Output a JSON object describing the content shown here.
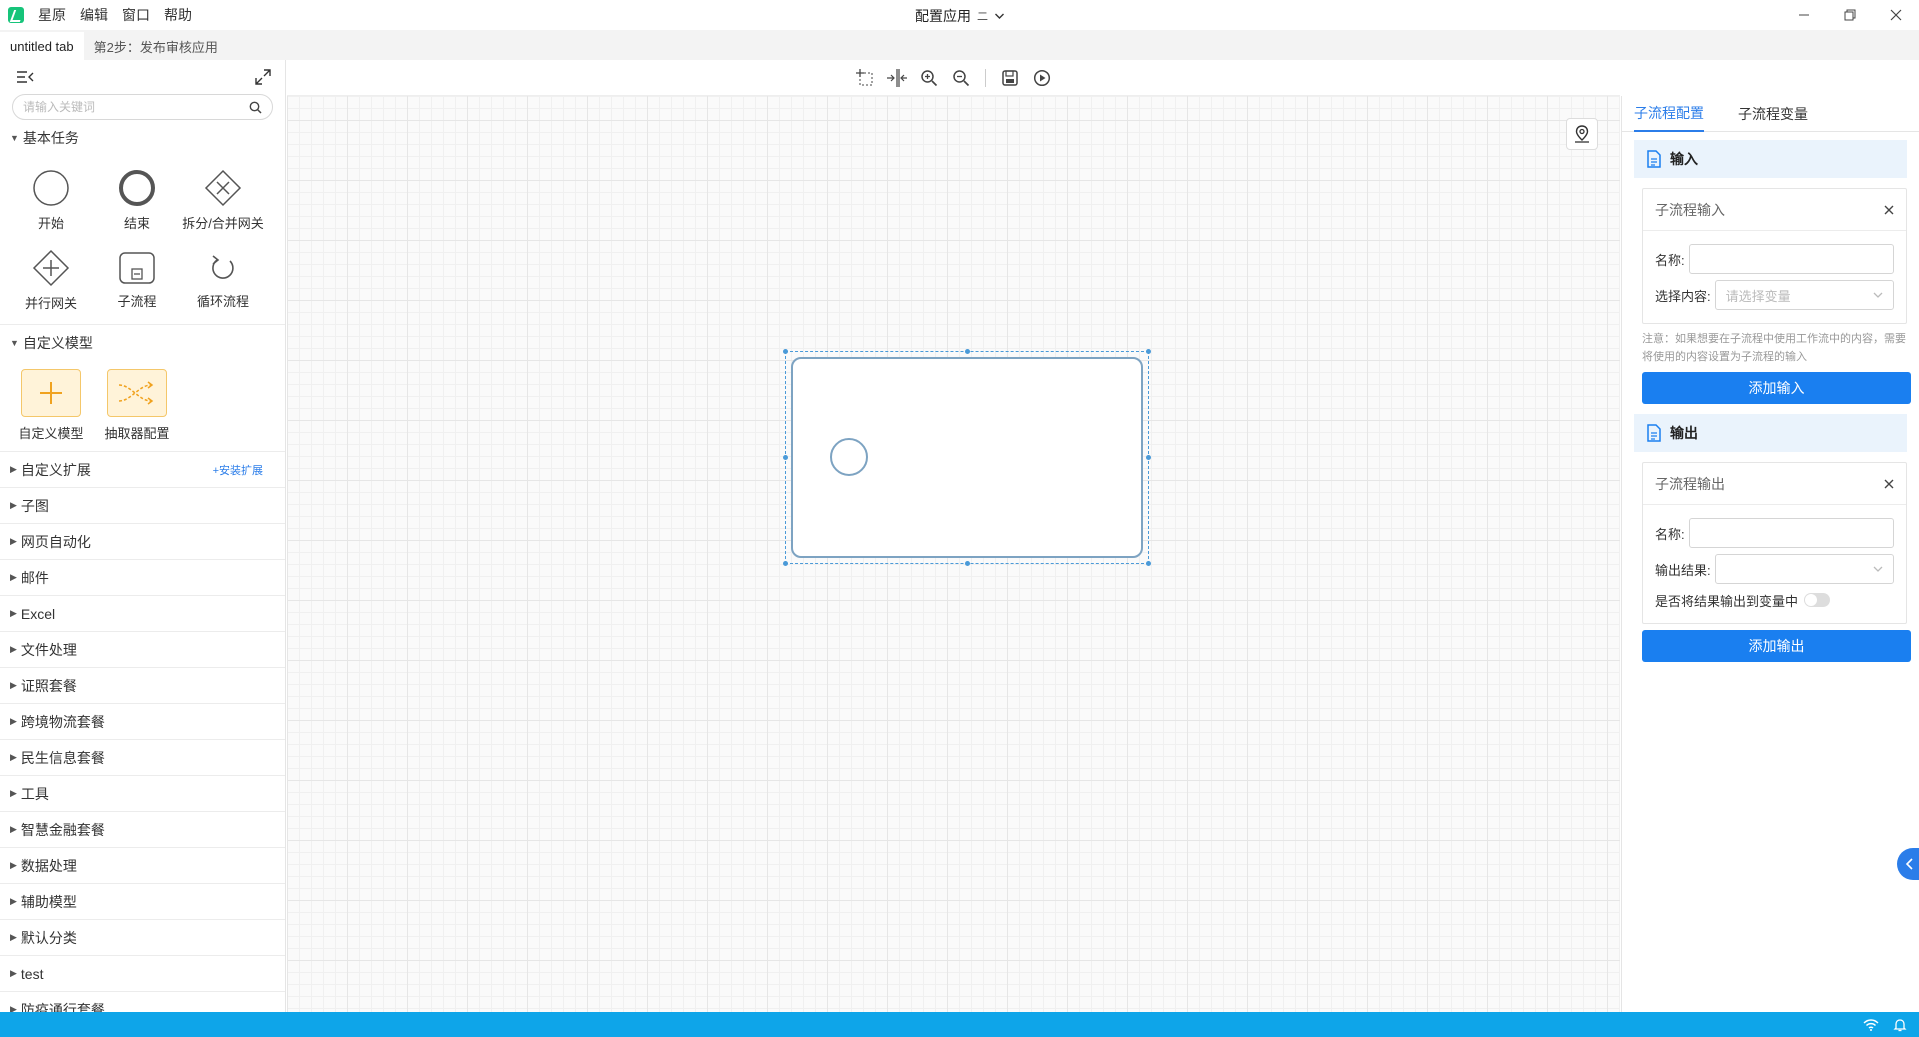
{
  "titlebar": {
    "menu": [
      "星原",
      "编辑",
      "窗口",
      "帮助"
    ],
    "title": "配置应用",
    "version": "二"
  },
  "tabs": [
    "untitled tab",
    "第2步：发布审核应用"
  ],
  "left_panel": {
    "search_placeholder": "请输入关键词",
    "basic_category": "基本任务",
    "basic_tools": [
      "开始",
      "结束",
      "拆分/合并网关",
      "并行网关",
      "子流程",
      "循环流程"
    ],
    "custom_model_category": "自定义模型",
    "custom_tools": [
      "自定义模型",
      "抽取器配置"
    ],
    "custom_ext": {
      "label": "自定义扩展",
      "action": "+安装扩展"
    },
    "categories": [
      "子图",
      "网页自动化",
      "邮件",
      "Excel",
      "文件处理",
      "证照套餐",
      "跨境物流套餐",
      "民生信息套餐",
      "工具",
      "智慧金融套餐",
      "数据处理",
      "辅助模型",
      "默认分类",
      "test",
      "防疫通行套餐"
    ]
  },
  "right_panel": {
    "tabs": [
      "子流程配置",
      "子流程变量"
    ],
    "input_section": {
      "title": "输入",
      "card_title": "子流程输入",
      "name_label": "名称:",
      "select_label": "选择内容:",
      "select_placeholder": "请选择变量",
      "note": "注意：如果想要在子流程中使用工作流中的内容，需要将使用的内容设置为子流程的输入",
      "button": "添加输入"
    },
    "output_section": {
      "title": "输出",
      "card_title": "子流程输出",
      "name_label": "名称:",
      "result_label": "输出结果:",
      "toggle_label": "是否将结果输出到变量中",
      "button": "添加输出"
    }
  },
  "colors": {
    "accent": "#1a7ff0",
    "status_bar": "#0ea5e9",
    "node_stroke": "#7da3c2",
    "selection": "#4a9ad8"
  }
}
